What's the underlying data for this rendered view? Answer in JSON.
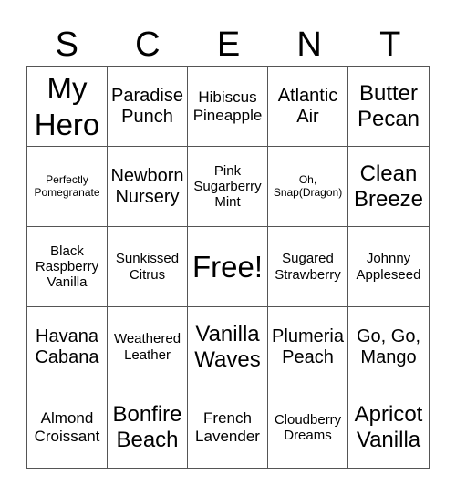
{
  "title_letters": [
    "S",
    "C",
    "E",
    "N",
    "T"
  ],
  "cells": [
    {
      "text": "My Hero",
      "size": "xl"
    },
    {
      "text": "Paradise Punch",
      "size": "md"
    },
    {
      "text": "Hibiscus Pineapple",
      "size": "sm"
    },
    {
      "text": "Atlantic Air",
      "size": "md"
    },
    {
      "text": "Butter Pecan",
      "size": "lg"
    },
    {
      "text": "Perfectly Pomegranate",
      "size": "xxs"
    },
    {
      "text": "Newborn Nursery",
      "size": "md"
    },
    {
      "text": "Pink Sugarberry Mint",
      "size": "xs"
    },
    {
      "text": "Oh, Snap(Dragon)",
      "size": "xxs"
    },
    {
      "text": "Clean Breeze",
      "size": "lg"
    },
    {
      "text": "Black Raspberry Vanilla",
      "size": "xs"
    },
    {
      "text": "Sunkissed Citrus",
      "size": "xs"
    },
    {
      "text": "Free!",
      "size": "xl"
    },
    {
      "text": "Sugared Strawberry",
      "size": "xs"
    },
    {
      "text": "Johnny Appleseed",
      "size": "xs"
    },
    {
      "text": "Havana Cabana",
      "size": "md"
    },
    {
      "text": "Weathered Leather",
      "size": "xs"
    },
    {
      "text": "Vanilla Waves",
      "size": "lg"
    },
    {
      "text": "Plumeria Peach",
      "size": "md"
    },
    {
      "text": "Go, Go, Mango",
      "size": "md"
    },
    {
      "text": "Almond Croissant",
      "size": "sm"
    },
    {
      "text": "Bonfire Beach",
      "size": "lg"
    },
    {
      "text": "French Lavender",
      "size": "sm"
    },
    {
      "text": "Cloudberry Dreams",
      "size": "xs"
    },
    {
      "text": "Apricot Vanilla",
      "size": "lg"
    }
  ]
}
